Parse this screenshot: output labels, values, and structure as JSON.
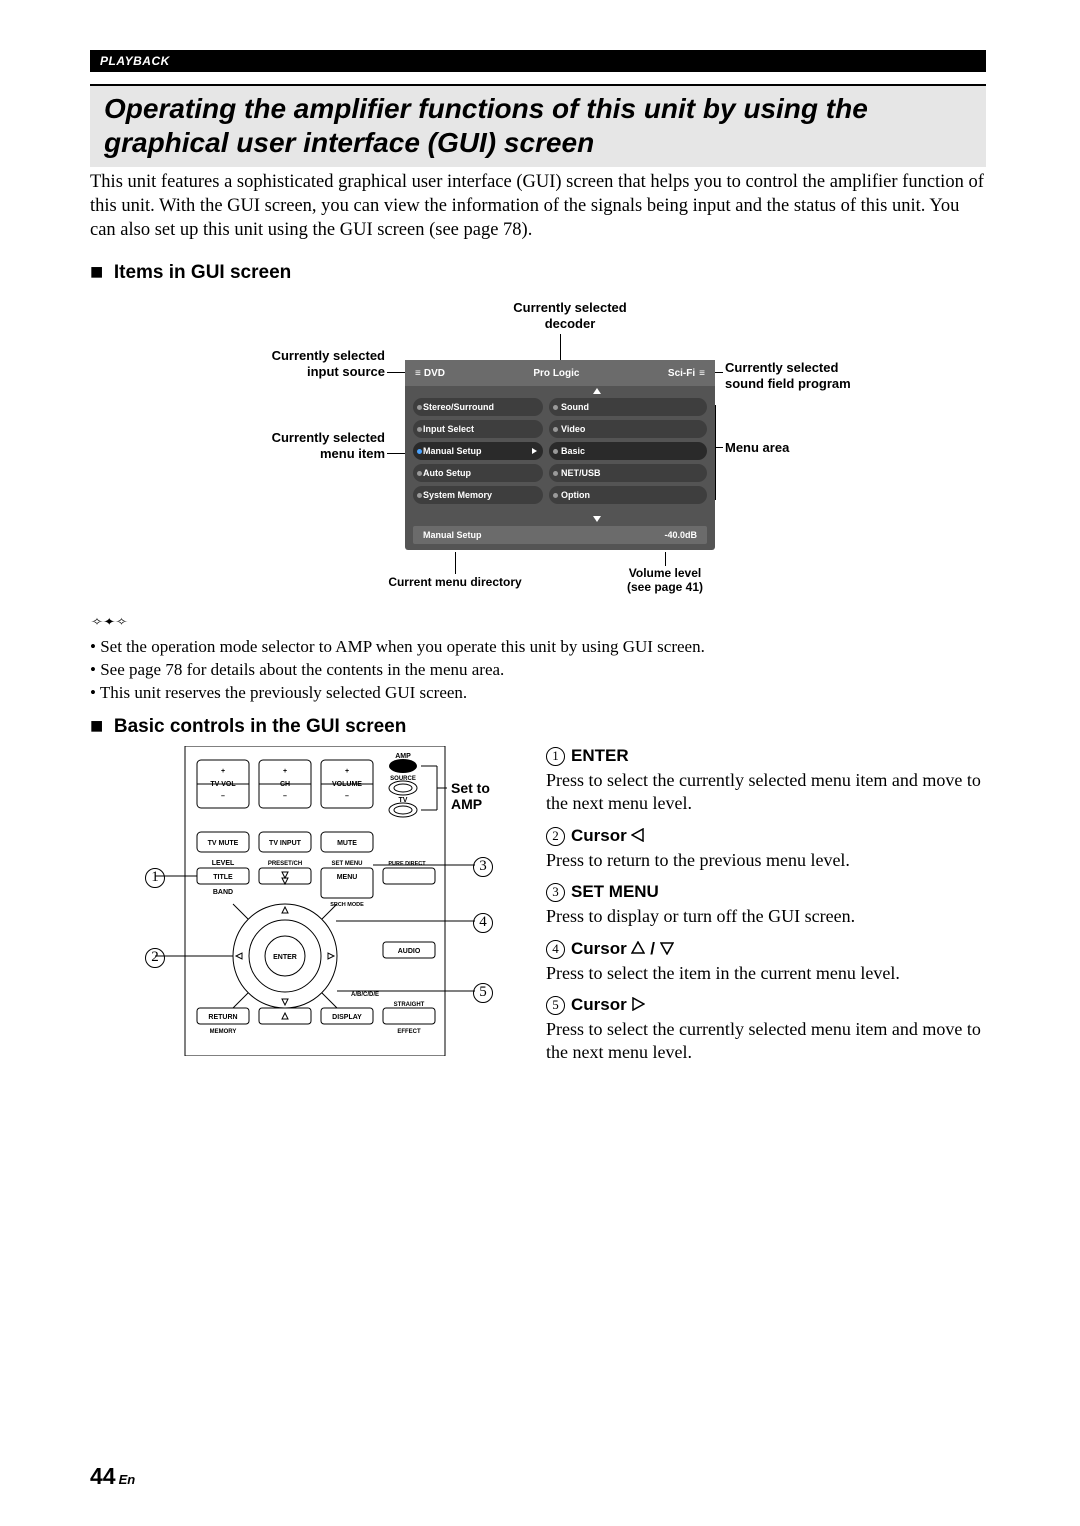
{
  "header": {
    "section": "PLAYBACK"
  },
  "title": "Operating the amplifier functions of this unit by using the graphical user interface (GUI) screen",
  "intro": "This unit features a sophisticated graphical user interface (GUI) screen that helps you to control the amplifier function of this unit. With the GUI screen, you can view the information of the signals being input and the status of this unit. You can also set up this unit using the GUI screen (see page 78).",
  "section1_heading": "Items in GUI screen",
  "gui": {
    "input_source": "DVD",
    "decoder": "Pro Logic",
    "sfp": "Sci-Fi",
    "left_menu": [
      "Stereo/Surround",
      "Input Select",
      "Manual Setup",
      "Auto Setup",
      "System Memory"
    ],
    "right_menu": [
      "Sound",
      "Video",
      "Basic",
      "NET/USB",
      "Option"
    ],
    "selected_left_index": 2,
    "selected_right_index": 2,
    "status_left": "Manual Setup",
    "status_right": "-40.0dB"
  },
  "callouts": {
    "decoder": "Currently selected decoder",
    "input": "Currently selected input source",
    "sfp_line1": "Currently selected",
    "sfp_line2": "sound field program",
    "menu_item": "Currently selected menu item",
    "menu_area": "Menu area",
    "dir": "Current menu directory",
    "vol_line1": "Volume level",
    "vol_line2": "(see page 41)"
  },
  "tips": [
    "Set the operation mode selector to AMP when you operate this unit by using GUI screen.",
    "See page 78 for details about the contents in the menu area.",
    "This unit reserves the previously selected GUI screen."
  ],
  "section2_heading": "Basic controls in the GUI screen",
  "set_to_amp": "Set to AMP",
  "remote_labels": {
    "amp": "AMP",
    "source": "SOURCE",
    "tv": "TV",
    "tvvol": "TV VOL",
    "ch": "CH",
    "volume": "VOLUME",
    "tvmute": "TV MUTE",
    "tvinput": "TV INPUT",
    "mute": "MUTE",
    "level": "LEVEL",
    "presetch": "PRESET/CH",
    "setmenu": "SET MENU",
    "puredirect": "PURE DIRECT",
    "title": "TITLE",
    "menu": "MENU",
    "band": "BAND",
    "srchmode": "SRCH MODE",
    "enter": "ENTER",
    "audio": "AUDIO",
    "abcde": "A/B/C/D/E",
    "straight": "STRAIGHT",
    "return": "RETURN",
    "display": "DISPLAY",
    "memory": "MEMORY",
    "effect": "EFFECT"
  },
  "controls": [
    {
      "num": "1",
      "label": "ENTER",
      "desc": "Press to select the currently selected menu item and move to the next menu level."
    },
    {
      "num": "2",
      "label_prefix": "Cursor ",
      "symbol": "left-outline",
      "desc": "Press to return to the previous menu level."
    },
    {
      "num": "3",
      "label": "SET MENU",
      "desc": "Press to display or turn off the GUI screen."
    },
    {
      "num": "4",
      "label_prefix": "Cursor ",
      "symbol": "updown-outline",
      "desc": "Press to select the item in the current menu level."
    },
    {
      "num": "5",
      "label_prefix": "Cursor ",
      "symbol": "right-outline",
      "desc": "Press to select the currently selected menu item and move to the next menu level."
    }
  ],
  "footer": {
    "page": "44",
    "lang": "En"
  }
}
